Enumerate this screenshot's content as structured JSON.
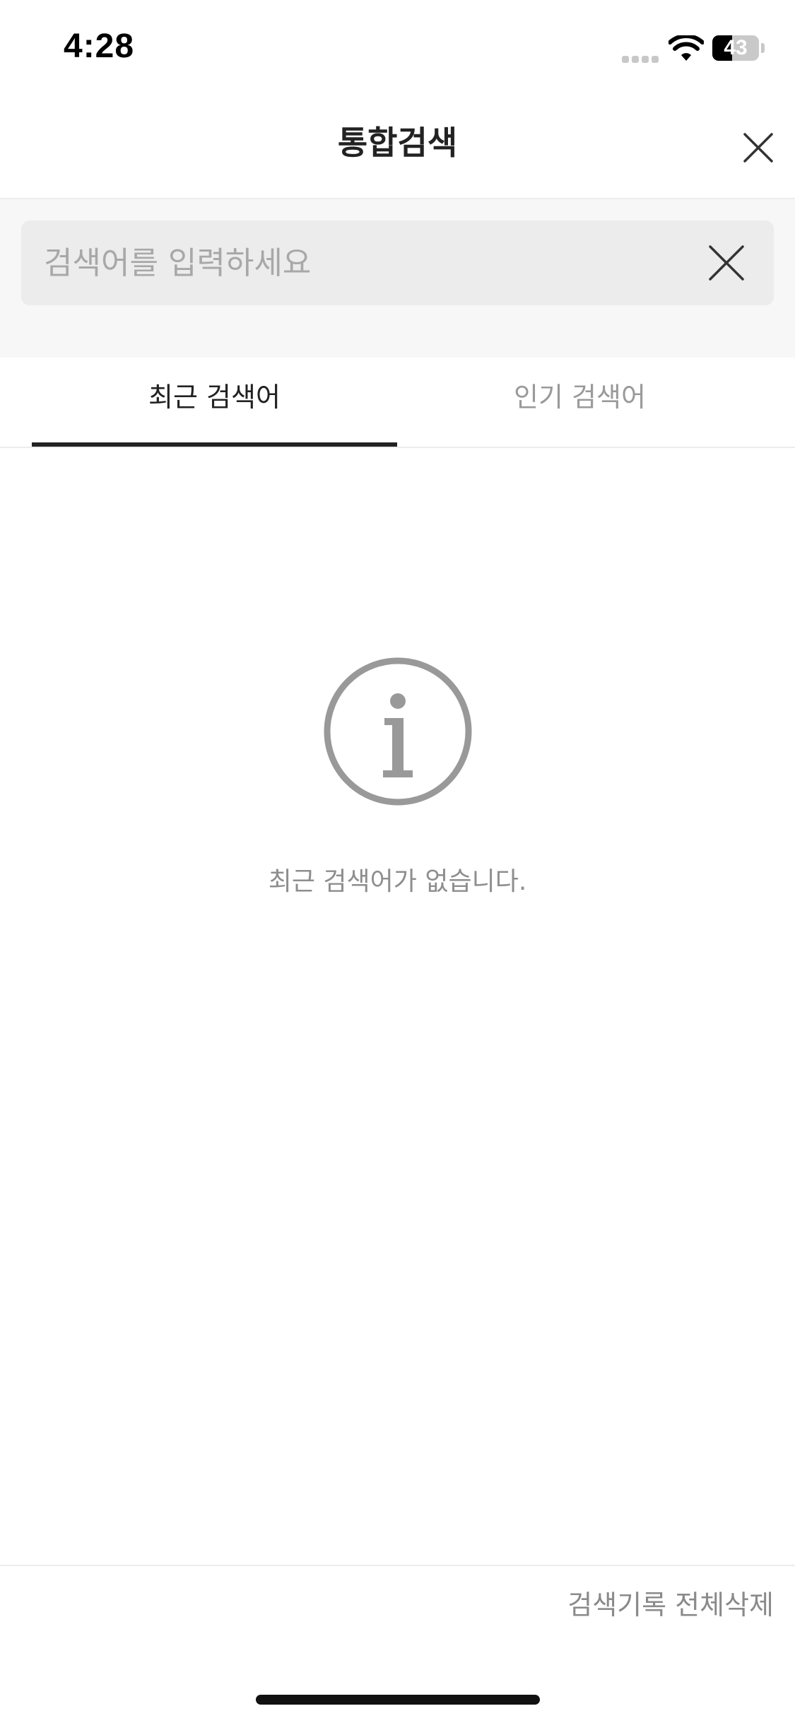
{
  "status_bar": {
    "time": "4:28",
    "battery_percent": 43,
    "battery_label": "43"
  },
  "header": {
    "title": "통합검색"
  },
  "search": {
    "value": "",
    "placeholder": "검색어를 입력하세요"
  },
  "tabs": [
    {
      "label": "최근 검색어",
      "active": true
    },
    {
      "label": "인기 검색어",
      "active": false
    }
  ],
  "empty_state": {
    "icon": "info-icon",
    "message": "최근 검색어가 없습니다."
  },
  "footer": {
    "delete_all_label": "검색기록 전체삭제"
  },
  "colors": {
    "accent": "#222222",
    "muted_text": "#8e8e8e",
    "icon_gray": "#999999",
    "search_bg": "#ececec",
    "panel_bg": "#f7f7f7"
  }
}
